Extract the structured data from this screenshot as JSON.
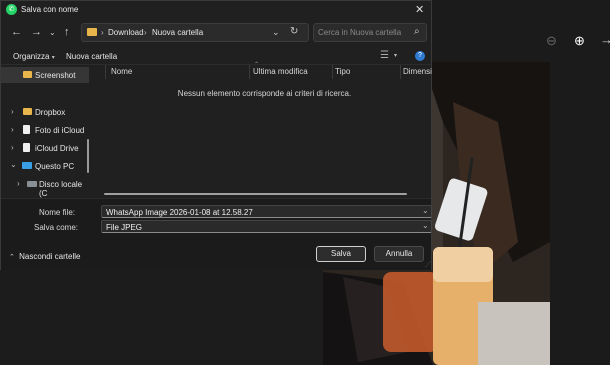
{
  "dialog": {
    "title": "Salva con nome",
    "close_glyph": "✕",
    "app_icon": "whatsapp-icon"
  },
  "address": {
    "crumbs": [
      "Download",
      "Nuova cartella"
    ]
  },
  "search": {
    "placeholder": "Cerca in Nuova cartella"
  },
  "toolbar": {
    "organize_label": "Organizza",
    "new_folder_label": "Nuova cartella"
  },
  "navpane": {
    "items": [
      {
        "label": "Screenshot",
        "selected": true
      },
      {
        "label": "Dropbox"
      },
      {
        "label": "Foto di iCloud"
      },
      {
        "label": "iCloud Drive"
      },
      {
        "label": "Questo PC"
      },
      {
        "label": "Disco locale (C"
      }
    ]
  },
  "filelist": {
    "columns": [
      "Nome",
      "Ultima modifica",
      "Tipo",
      "Dimensio"
    ],
    "empty_message": "Nessun elemento corrisponde ai criteri di ricerca."
  },
  "form": {
    "filename_label": "Nome file:",
    "filename_value": "WhatsApp Image 2026-01-08 at 12.58.27",
    "type_label": "Salva come:",
    "type_value": "File JPEG"
  },
  "footer": {
    "hide_folders_label": "Nascondi cartelle",
    "save_label": "Salva",
    "cancel_label": "Annulla"
  },
  "colors": {
    "accent": "#2f7bd3",
    "folder": "#e8b64a"
  }
}
